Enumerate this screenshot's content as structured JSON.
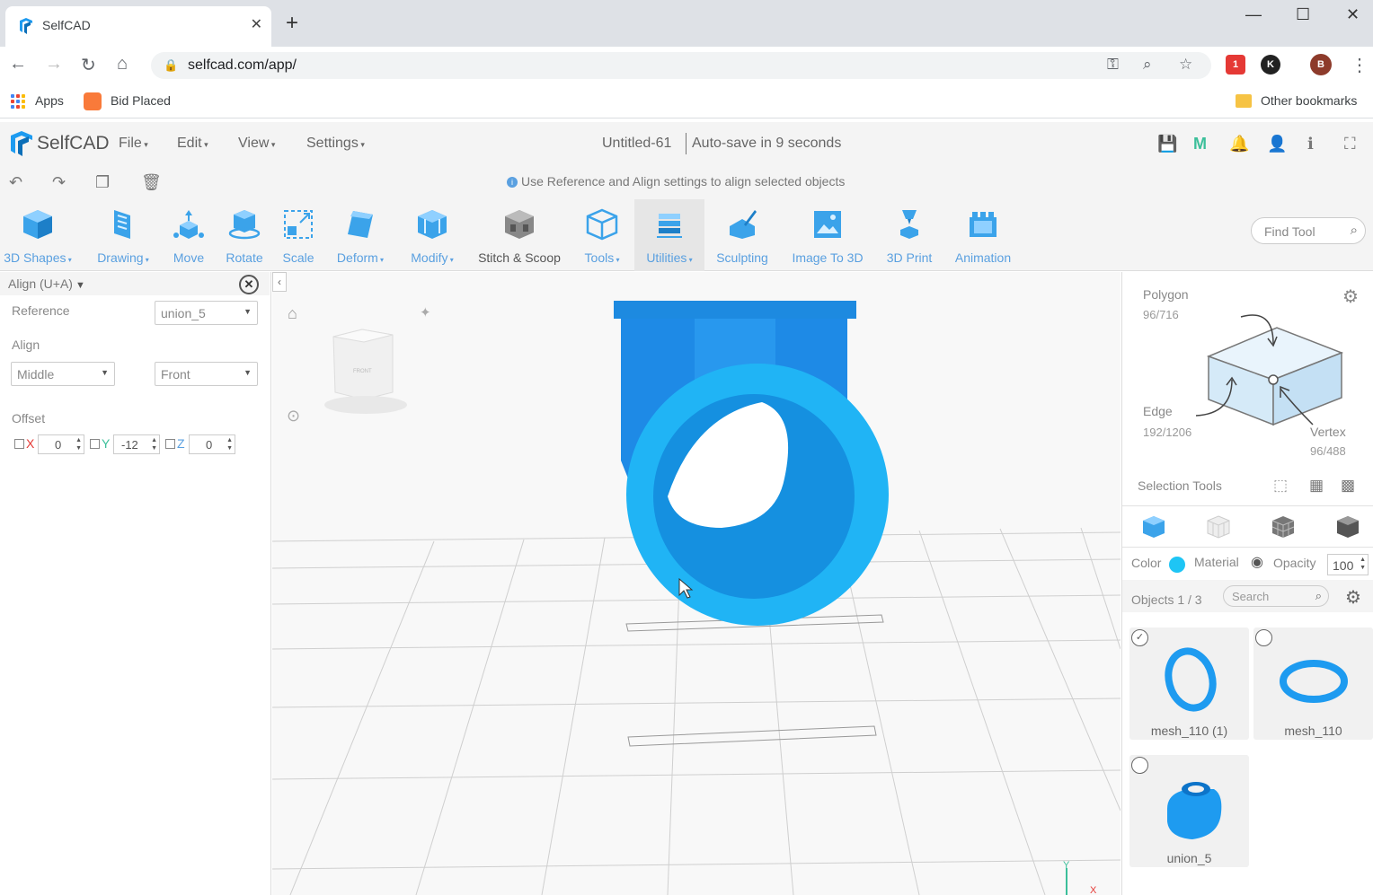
{
  "browser": {
    "tab_title": "SelfCAD",
    "url": "selfcad.com/app/",
    "bookmarks": [
      {
        "label": "Apps"
      },
      {
        "label": "Bid Placed"
      },
      {
        "label": "Other bookmarks"
      }
    ],
    "profile_initial": "B",
    "ext_initial": "K",
    "ext_badge": "1"
  },
  "app": {
    "logo": "SelfCAD",
    "menus": [
      "File",
      "Edit",
      "View",
      "Settings"
    ],
    "doc_title": "Untitled-61",
    "autosave": "Auto-save in 9 seconds",
    "hint": "Use Reference and Align settings to align selected objects",
    "accent": "#5aa0e0"
  },
  "toolbar": {
    "tools": [
      {
        "label": "3D Shapes",
        "dropdown": true
      },
      {
        "label": "Drawing",
        "dropdown": true
      },
      {
        "label": "Move",
        "dropdown": false
      },
      {
        "label": "Rotate",
        "dropdown": false
      },
      {
        "label": "Scale",
        "dropdown": false
      },
      {
        "label": "Deform",
        "dropdown": true
      },
      {
        "label": "Modify",
        "dropdown": true
      },
      {
        "label": "Stitch & Scoop",
        "dropdown": false
      },
      {
        "label": "Tools",
        "dropdown": true
      },
      {
        "label": "Utilities",
        "dropdown": true
      },
      {
        "label": "Sculpting",
        "dropdown": false
      },
      {
        "label": "Image To 3D",
        "dropdown": false
      },
      {
        "label": "3D Print",
        "dropdown": false
      },
      {
        "label": "Animation",
        "dropdown": false
      }
    ],
    "find_tool_placeholder": "Find Tool"
  },
  "align_panel": {
    "title": "Align (U+A)",
    "reference_label": "Reference",
    "reference_value": "union_5",
    "align_label": "Align",
    "align_value": "Middle",
    "align_direction": "Front",
    "offset_label": "Offset",
    "offset": {
      "x": "0",
      "y": "-12",
      "z": "0"
    },
    "axis_labels": {
      "x": "X",
      "y": "Y",
      "z": "Z"
    }
  },
  "viewport": {
    "cube_face": "FRONT",
    "axis_y": "Y",
    "axis_x": "X"
  },
  "right_panel": {
    "polygon_label": "Polygon",
    "polygon_count": "96/716",
    "edge_label": "Edge",
    "edge_count": "192/1206",
    "vertex_label": "Vertex",
    "vertex_count": "96/488",
    "selection_tools_label": "Selection Tools",
    "color_label": "Color",
    "material_label": "Material",
    "opacity_label": "Opacity",
    "opacity_value": "100",
    "objects_label": "Objects 1 / 3",
    "search_placeholder": "Search",
    "object_color": "#1e9bf0",
    "objects": [
      {
        "name": "mesh_110 (1)",
        "checked": true
      },
      {
        "name": "mesh_110",
        "checked": false
      },
      {
        "name": "union_5",
        "checked": false
      }
    ]
  }
}
